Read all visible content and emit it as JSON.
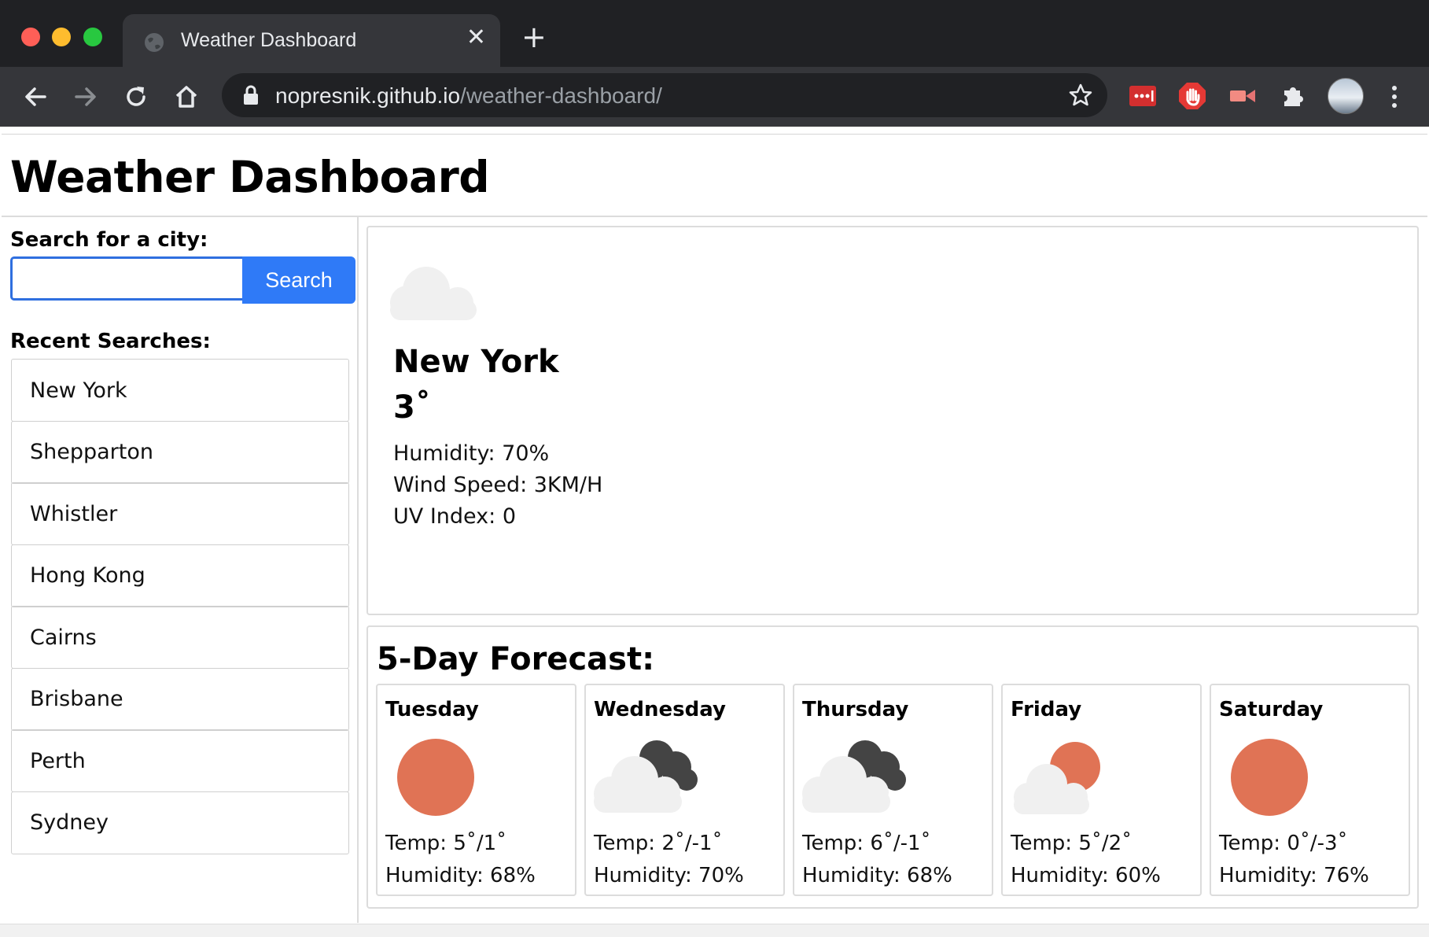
{
  "browser": {
    "tab_title": "Weather Dashboard",
    "url_host": "nopresnik.github.io",
    "url_path": "/weather-dashboard/"
  },
  "header": {
    "title": "Weather Dashboard"
  },
  "sidebar": {
    "search_label": "Search for a city:",
    "search_value": "",
    "search_button": "Search",
    "recent_label": "Recent Searches:",
    "recent": [
      "New York",
      "Shepparton",
      "Whistler",
      "Hong Kong",
      "Cairns",
      "Brisbane",
      "Perth",
      "Sydney"
    ]
  },
  "current": {
    "icon": "cloudy-icon",
    "city": "New York",
    "temp": "3˚",
    "humidity": "Humidity: 70%",
    "wind": "Wind Speed: 3KM/H",
    "uv": "UV Index: 0"
  },
  "forecast": {
    "title": "5-Day Forecast:",
    "days": [
      {
        "name": "Tuesday",
        "icon": "sun-icon",
        "temp": "Temp: 5˚/1˚",
        "humidity": "Humidity: 68%"
      },
      {
        "name": "Wednesday",
        "icon": "dark-clouds-icon",
        "temp": "Temp: 2˚/-1˚",
        "humidity": "Humidity: 70%"
      },
      {
        "name": "Thursday",
        "icon": "dark-clouds-icon",
        "temp": "Temp: 6˚/-1˚",
        "humidity": "Humidity: 68%"
      },
      {
        "name": "Friday",
        "icon": "partly-cloudy-icon",
        "temp": "Temp: 5˚/2˚",
        "humidity": "Humidity: 60%"
      },
      {
        "name": "Saturday",
        "icon": "sun-icon",
        "temp": "Temp: 0˚/-3˚",
        "humidity": "Humidity: 76%"
      }
    ]
  },
  "colors": {
    "accent": "#2f7af7",
    "sun": "#e07355",
    "cloud_light": "#f0f0f0",
    "cloud_dark": "#444444"
  }
}
